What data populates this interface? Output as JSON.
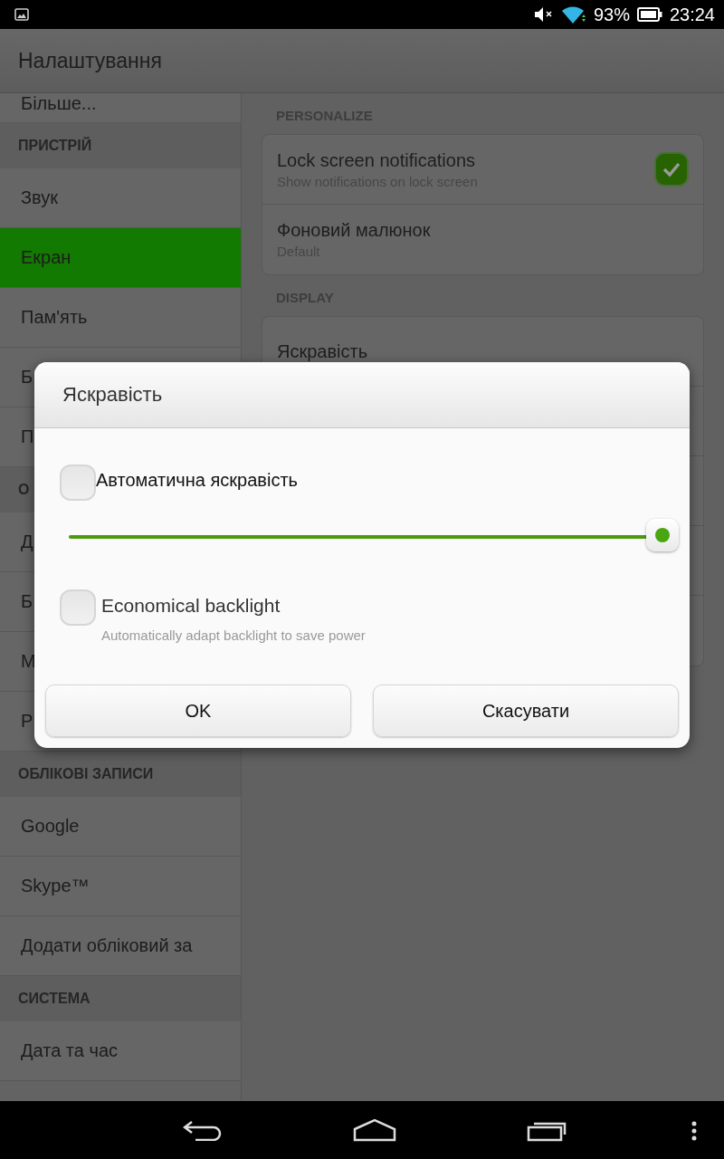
{
  "status_bar": {
    "battery": "93%",
    "time": "23:24"
  },
  "action_bar": {
    "title": "Налаштування"
  },
  "sidebar": {
    "items": [
      {
        "kind": "item",
        "label": "Більше...",
        "selected": false
      },
      {
        "kind": "header",
        "label": "ПРИСТРІЙ"
      },
      {
        "kind": "item",
        "label": "Звук",
        "selected": false
      },
      {
        "kind": "item",
        "label": "Екран",
        "selected": true
      },
      {
        "kind": "item",
        "label": "Пам'ять",
        "selected": false
      },
      {
        "kind": "item",
        "label": "Б",
        "selected": false
      },
      {
        "kind": "item",
        "label": "П",
        "selected": false
      },
      {
        "kind": "header",
        "label": "О"
      },
      {
        "kind": "item",
        "label": "Д",
        "selected": false
      },
      {
        "kind": "item",
        "label": "Б",
        "selected": false
      },
      {
        "kind": "item",
        "label": "М",
        "selected": false
      },
      {
        "kind": "item",
        "label": "Р",
        "selected": false
      },
      {
        "kind": "header",
        "label": "ОБЛІКОВІ ЗАПИСИ"
      },
      {
        "kind": "item",
        "label": "Google",
        "selected": false
      },
      {
        "kind": "item",
        "label": "Skype™",
        "selected": false
      },
      {
        "kind": "item",
        "label": "Додати обліковий за",
        "selected": false
      },
      {
        "kind": "header",
        "label": "СИСТЕМА"
      },
      {
        "kind": "item",
        "label": "Дата та час",
        "selected": false
      }
    ]
  },
  "content": {
    "sections": [
      {
        "header": "PERSONALIZE",
        "rows": [
          {
            "title": "Lock screen notifications",
            "subtitle": "Show notifications on lock screen",
            "checked": true
          },
          {
            "title": "Фоновий малюнок",
            "subtitle": "Default"
          }
        ]
      },
      {
        "header": "DISPLAY",
        "rows": [
          {
            "title": "Яскравість"
          }
        ]
      }
    ]
  },
  "dialog": {
    "title": "Яскравість",
    "options": [
      {
        "kind": "checkbox",
        "label": "Автоматична яскравість",
        "checked": false
      },
      {
        "kind": "slider",
        "level": 1
      },
      {
        "kind": "checkbox",
        "label": "Economical backlight",
        "subtitle": "Automatically adapt backlight to save power",
        "checked": false
      }
    ],
    "buttons": [
      "OK",
      "Скасувати"
    ]
  }
}
